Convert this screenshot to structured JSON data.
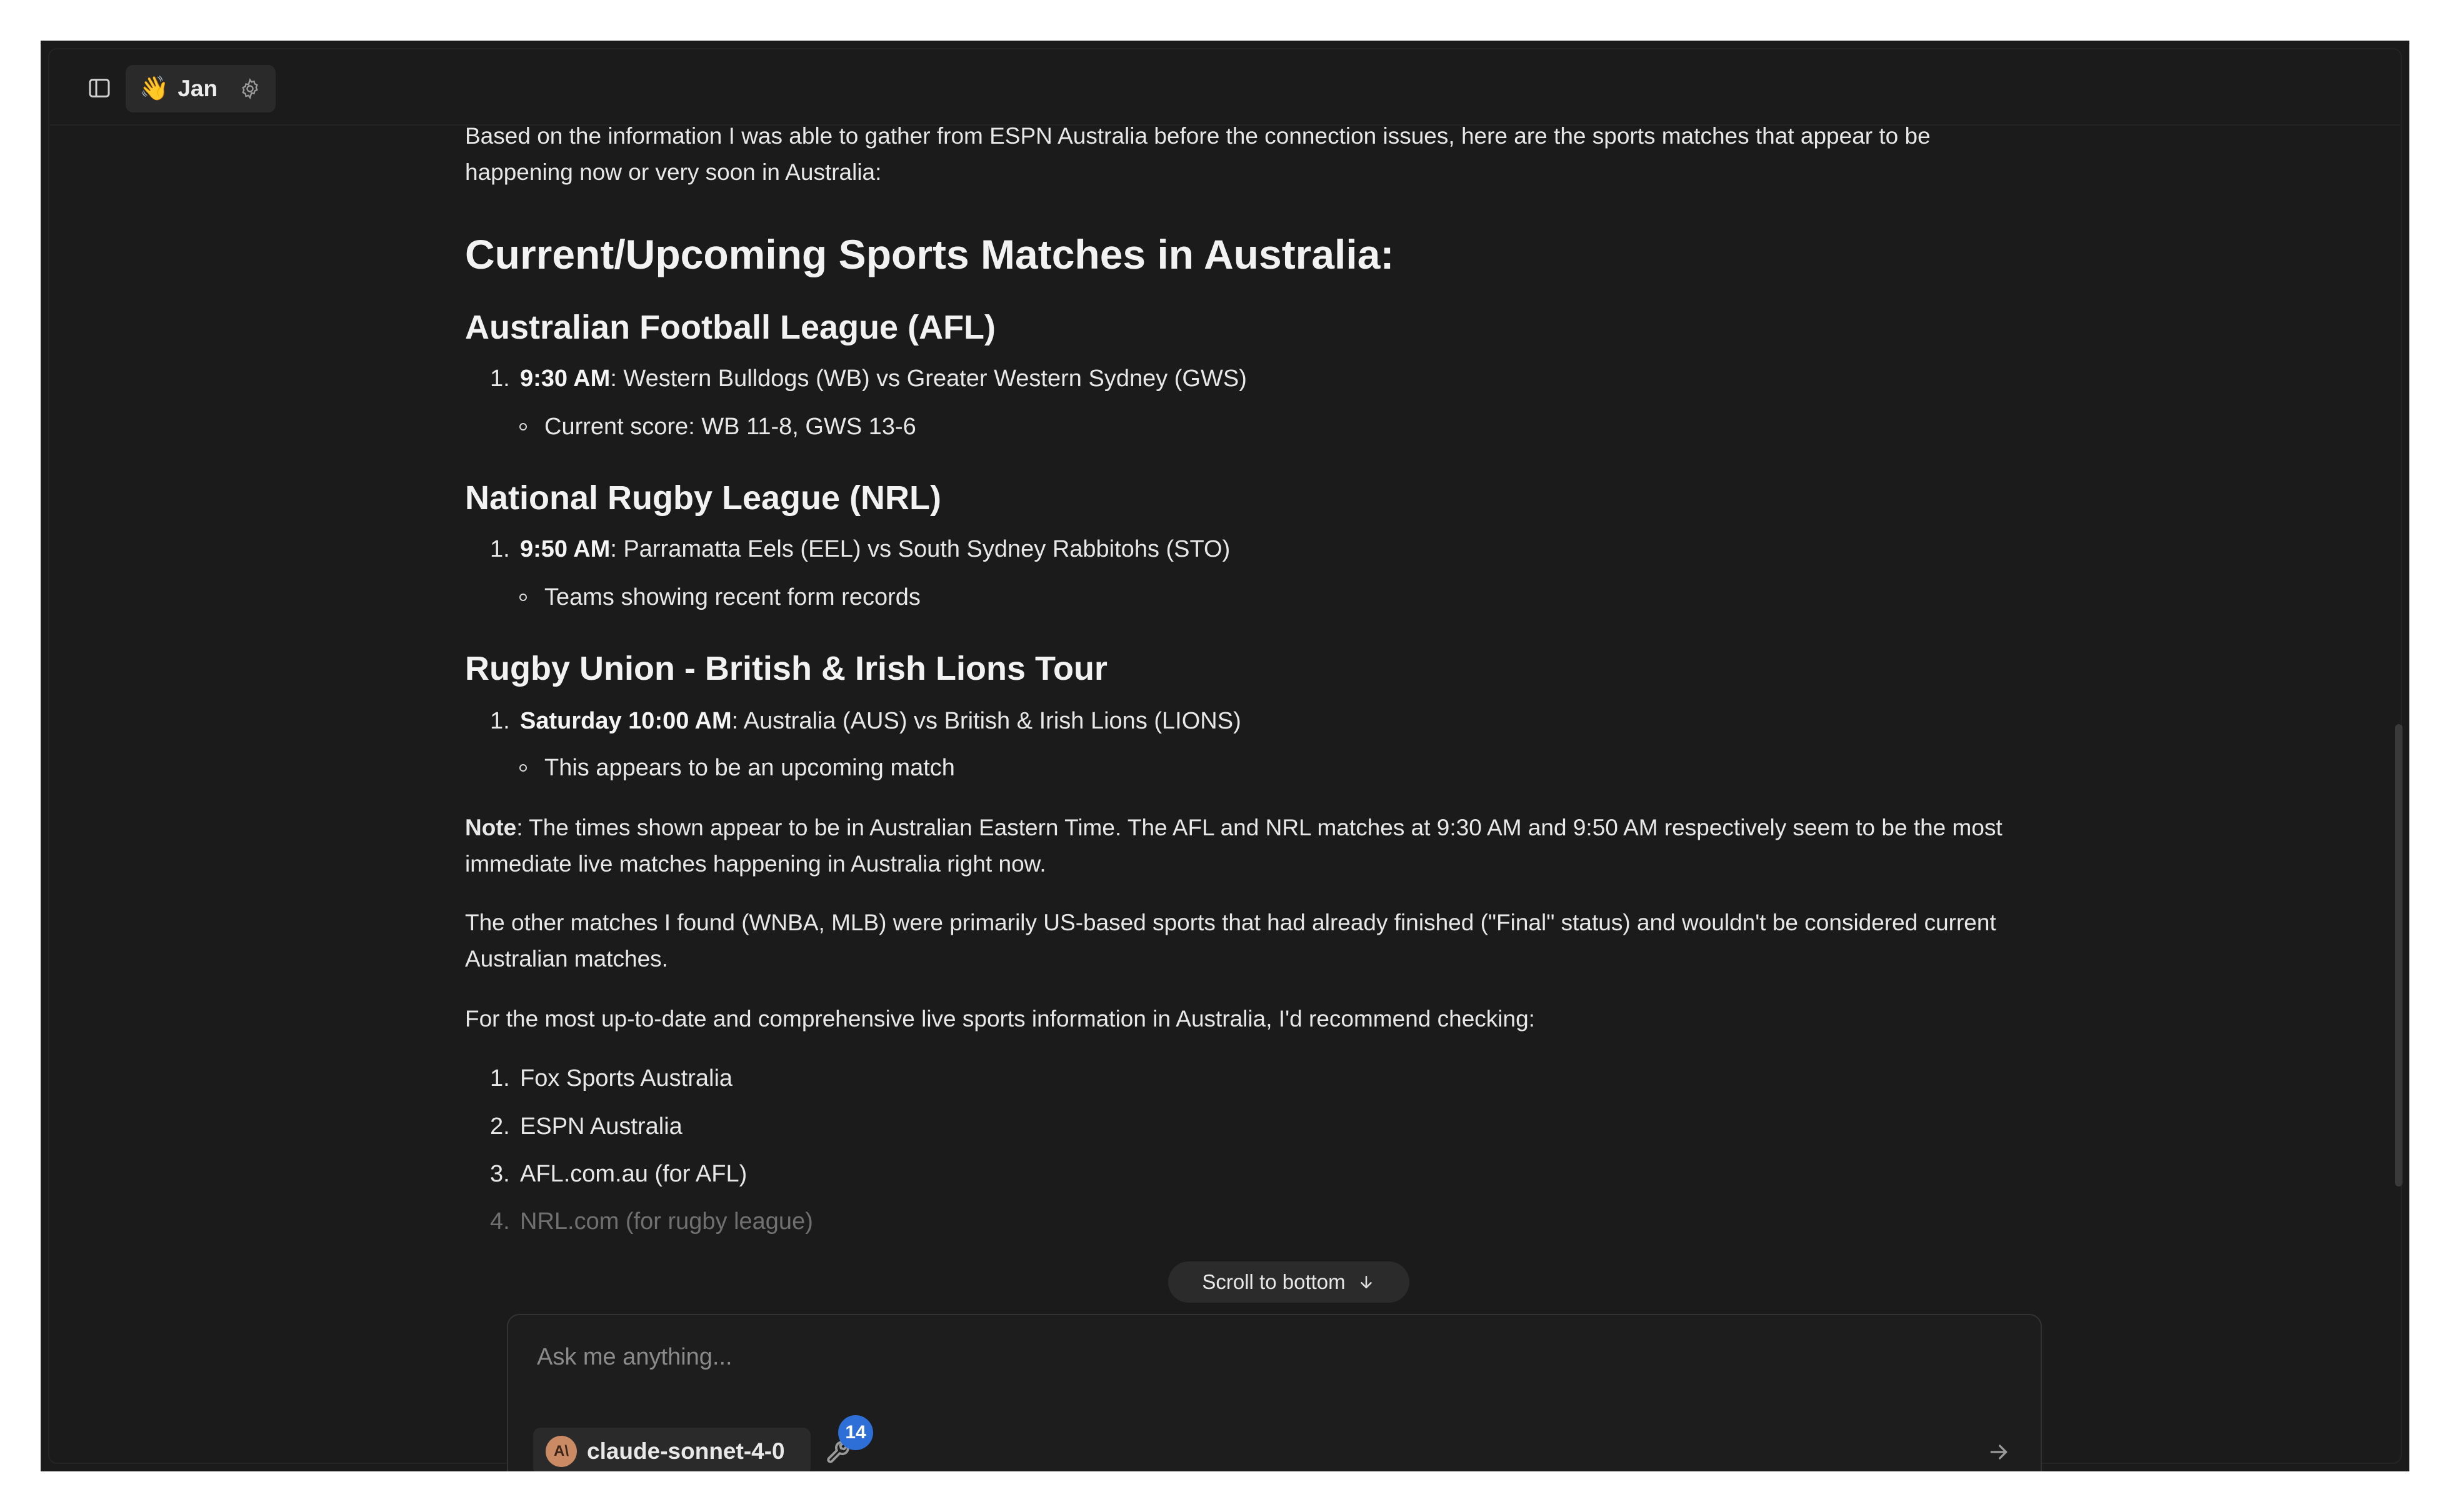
{
  "header": {
    "assistant_emoji": "👋",
    "assistant_name": "Jan",
    "icons": [
      "sidebar-toggle-icon",
      "gear-icon"
    ]
  },
  "message": {
    "intro": "Based on the information I was able to gather from ESPN Australia before the connection issues, here are the sports matches that appear to be happening now or very soon in Australia:",
    "heading": "Current/Upcoming Sports Matches in Australia:",
    "sections": [
      {
        "title": "Australian Football League (AFL)",
        "num": "1.",
        "time": "9:30 AM",
        "match": ": Western Bulldogs (WB) vs Greater Western Sydney (GWS)",
        "detail": "Current score: WB 11-8, GWS 13-6"
      },
      {
        "title": "National Rugby League (NRL)",
        "num": "1.",
        "time": "9:50 AM",
        "match": ": Parramatta Eels (EEL) vs South Sydney Rabbitohs (STO)",
        "detail": "Teams showing recent form records"
      },
      {
        "title": "Rugby Union - British & Irish Lions Tour",
        "num": "1.",
        "time": "Saturday 10:00 AM",
        "match": ": Australia (AUS) vs British & Irish Lions (LIONS)",
        "detail": "This appears to be an upcoming match"
      }
    ],
    "note_label": "Note",
    "note_text": ": The times shown appear to be in Australian Eastern Time. The AFL and NRL matches at 9:30 AM and 9:50 AM respectively seem to be the most immediate live matches happening in Australia right now.",
    "other_text": "The other matches I found (WNBA, MLB) were primarily US-based sports that had already finished (\"Final\" status) and wouldn't be considered current Australian matches.",
    "recommend_text": "For the most up-to-date and comprehensive live sports information in Australia, I'd recommend checking:",
    "sources": [
      {
        "num": "1.",
        "label": "Fox Sports Australia"
      },
      {
        "num": "2.",
        "label": "ESPN Australia"
      },
      {
        "num": "3.",
        "label": "AFL.com.au (for AFL)"
      },
      {
        "num": "4.",
        "label": "NRL.com (for rugby league)"
      }
    ]
  },
  "scroll_button": {
    "label": "Scroll to bottom",
    "icon": "arrow-down-icon"
  },
  "composer": {
    "placeholder": "Ask me anything...",
    "model_name": "claude-sonnet-4-0",
    "model_avatar_text": "A\\",
    "tools_count": "14",
    "send_icon": "arrow-right-icon"
  }
}
